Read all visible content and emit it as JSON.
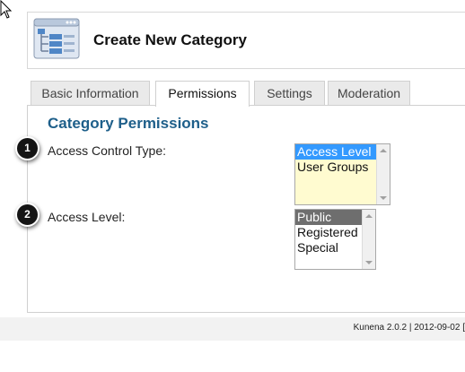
{
  "header": {
    "title": "Create New Category"
  },
  "tabs": [
    {
      "label": "Basic Information",
      "active": false
    },
    {
      "label": "Permissions",
      "active": true
    },
    {
      "label": "Settings",
      "active": false
    },
    {
      "label": "Moderation",
      "active": false
    }
  ],
  "section": {
    "title": "Category Permissions"
  },
  "fields": [
    {
      "step": "1",
      "label": "Access Control Type:",
      "options": [
        "Access Level",
        "User Groups"
      ],
      "selected": "Access Level",
      "background": "#fffbd0"
    },
    {
      "step": "2",
      "label": "Access Level:",
      "options": [
        "Public",
        "Registered",
        "Special"
      ],
      "selected": "Public",
      "background": "#ffffff"
    }
  ],
  "footer": {
    "text": "Kunena 2.0.2 | 2012-09-02 ["
  },
  "colors": {
    "section_title": "#1e5f8a",
    "selection_blue": "#3399ff",
    "selection_gray": "#6e6e6e"
  },
  "icons": {
    "cursor": "arrow-cursor-icon",
    "header": "category-tree-icon"
  }
}
